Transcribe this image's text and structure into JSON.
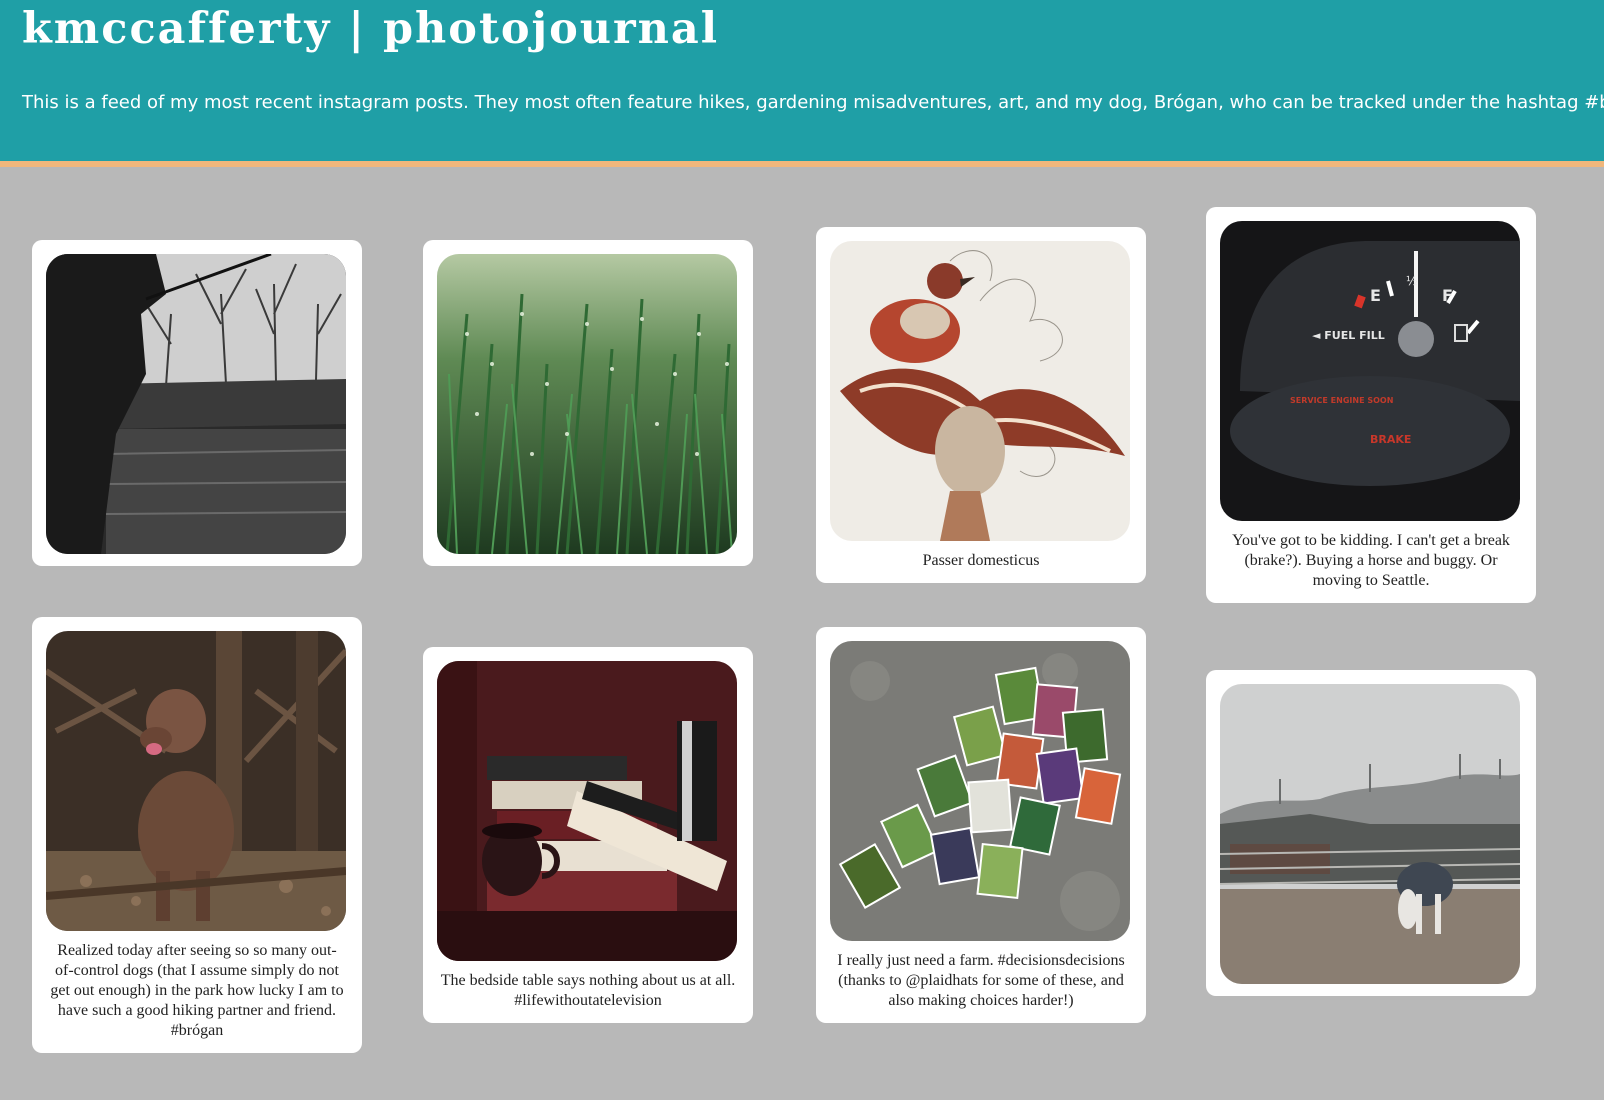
{
  "header": {
    "title": "kmccafferty | photojournal",
    "description": "This is a feed of my most recent instagram posts. They most often feature hikes, gardening misadventures, art, and my dog, Brógan, who can be tracked under the hashtag #brógan."
  },
  "colors": {
    "header_bg": "#1f9fa6",
    "header_border": "#f0b77c",
    "page_bg": "#b8b8b8",
    "card_bg": "#ffffff"
  },
  "posts": [
    {
      "image": "fishing-silhouette-photo",
      "caption": ""
    },
    {
      "image": "dewy-grass-photo",
      "caption": ""
    },
    {
      "image": "sparrow-illustration-photo",
      "caption": "Passer domesticus"
    },
    {
      "image": "fuel-gauge-dashboard-photo",
      "caption": "You've got to be kidding. I can't get a break (brake?). Buying a horse and buggy. Or moving to Seattle.",
      "dashboard": {
        "e": "E",
        "half": "½",
        "f": "F",
        "fuel_fill": "◄ FUEL FILL",
        "service": "SERVICE ENGINE SOON",
        "brake": "BRAKE"
      }
    },
    {
      "image": "dog-in-woods-photo",
      "caption": "Realized today after seeing so so many out-of-control dogs (that I assume simply do not get out enough) in the park how lucky I am to have such a good hiking partner and friend. #brógan"
    },
    {
      "image": "bedside-books-photo",
      "caption": "The bedside table says nothing about us at all. #lifewithoutatelevision"
    },
    {
      "image": "seed-packets-photo",
      "caption": "I really just need a farm. #decisionsdecisions (thanks to @plaidhats for some of these, and also making choices harder!)"
    },
    {
      "image": "horse-paddock-photo",
      "caption": ""
    }
  ]
}
